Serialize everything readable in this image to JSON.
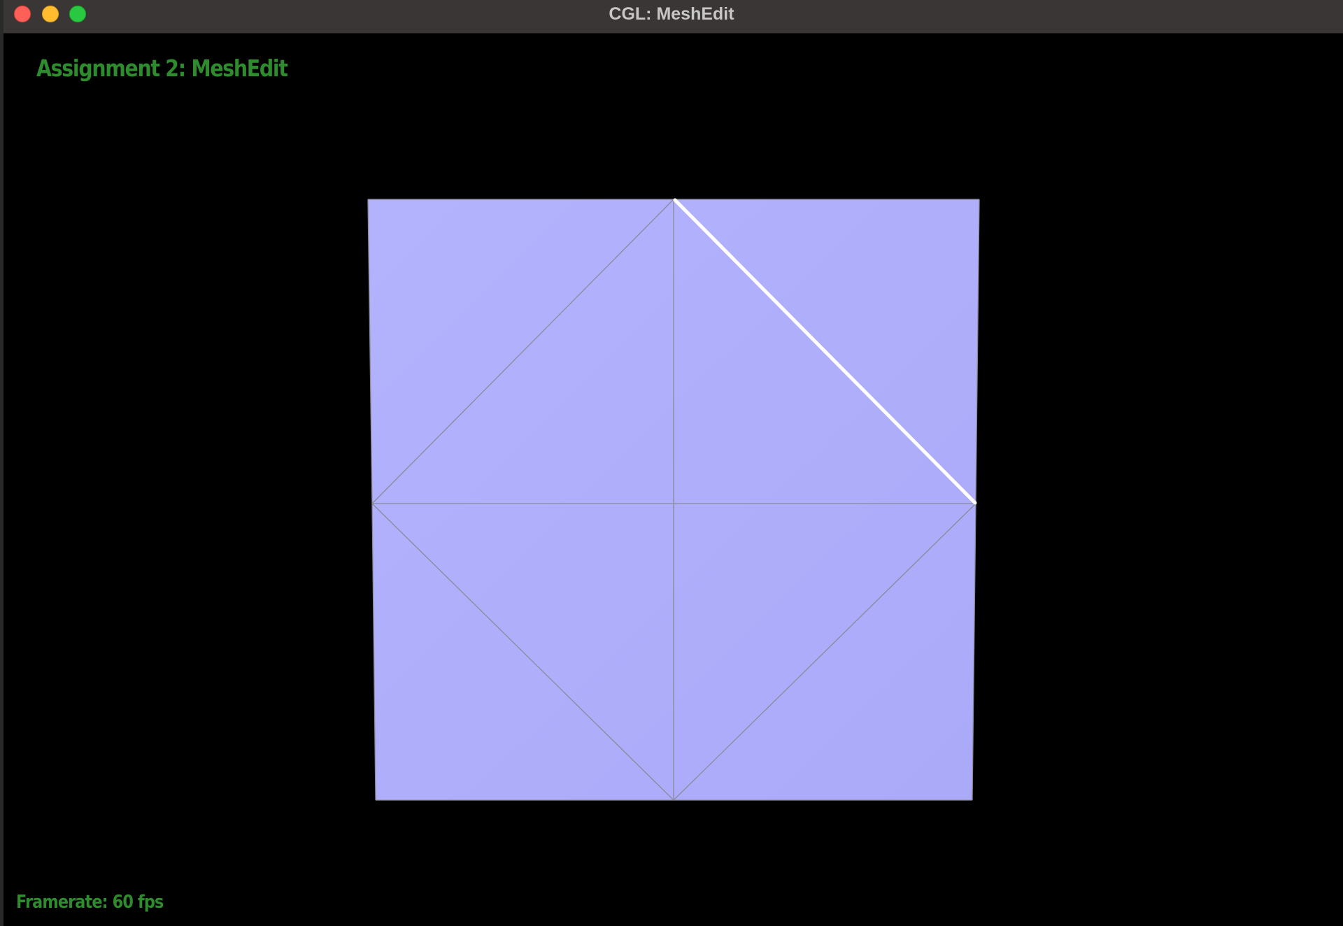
{
  "window": {
    "title": "CGL: MeshEdit"
  },
  "overlay": {
    "title": "Assignment 2: MeshEdit",
    "framerate": "Framerate: 60 fps"
  },
  "colors": {
    "background": "#000000",
    "mesh_face": "#b0b0fc",
    "mesh_edge": "#8a8a9a",
    "selected_edge": "#ffffff",
    "overlay_text": "#2e8b2e",
    "titlebar": "#3a3636"
  },
  "mesh": {
    "vertices": 9,
    "faces": 8,
    "selected_element": "edge"
  }
}
